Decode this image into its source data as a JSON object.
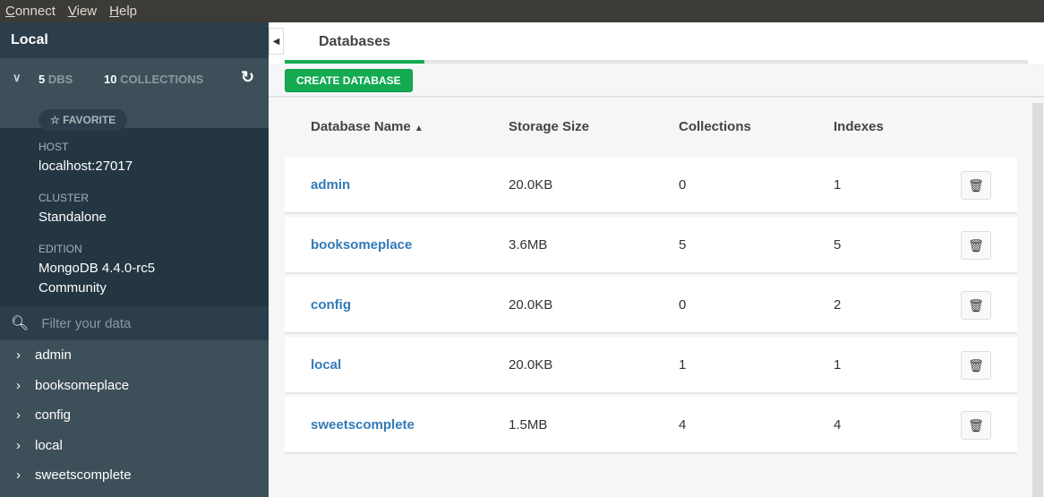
{
  "menu": [
    "Connect",
    "View",
    "Help"
  ],
  "sidebar": {
    "title": "Local",
    "dbs_count": "5",
    "dbs_label": "DBS",
    "collections_count": "10",
    "collections_label": "COLLECTIONS",
    "favorite": "☆ FAVORITE",
    "host_label": "HOST",
    "host": "localhost:27017",
    "cluster_label": "CLUSTER",
    "cluster": "Standalone",
    "edition_label": "EDITION",
    "edition": "MongoDB 4.4.0-rc5 Community",
    "filter_placeholder": "Filter your data",
    "databases": [
      "admin",
      "booksomeplace",
      "config",
      "local",
      "sweetscomplete"
    ]
  },
  "main": {
    "tab": "Databases",
    "create_button": "CREATE DATABASE",
    "columns": [
      "Database Name",
      "Storage Size",
      "Collections",
      "Indexes"
    ],
    "rows": [
      {
        "name": "admin",
        "size": "20.0KB",
        "collections": "0",
        "indexes": "1"
      },
      {
        "name": "booksomeplace",
        "size": "3.6MB",
        "collections": "5",
        "indexes": "5"
      },
      {
        "name": "config",
        "size": "20.0KB",
        "collections": "0",
        "indexes": "2"
      },
      {
        "name": "local",
        "size": "20.0KB",
        "collections": "1",
        "indexes": "1"
      },
      {
        "name": "sweetscomplete",
        "size": "1.5MB",
        "collections": "4",
        "indexes": "4"
      }
    ]
  }
}
